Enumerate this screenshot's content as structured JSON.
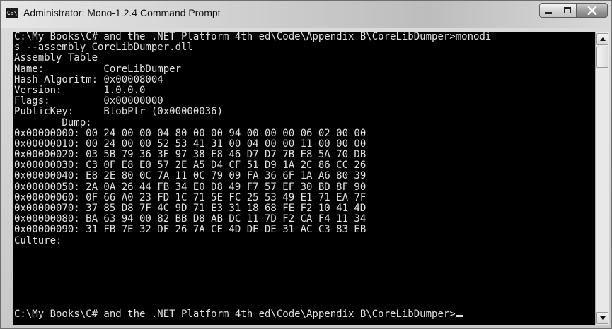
{
  "window": {
    "title": "Administrator: Mono-1.2.4 Command Prompt",
    "icon_name": "console-app-icon",
    "icon_text": "C:\\"
  },
  "controls": {
    "minimize_icon": "minimize-icon",
    "maximize_icon": "maximize-icon",
    "close_icon": "close-icon",
    "close_glyph": "✕"
  },
  "console": {
    "background": "#000000",
    "foreground": "#e0e0e0",
    "lines": [
      "C:\\My Books\\C# and the .NET Platform 4th ed\\Code\\Appendix B\\CoreLibDumper>monodi",
      "s --assembly CoreLibDumper.dll",
      "Assembly Table",
      "Name:          CoreLibDumper",
      "Hash Algoritm: 0x00008004",
      "Version:       1.0.0.0",
      "Flags:         0x00000000",
      "PublicKey:     BlobPtr (0x00000036)",
      "        Dump:",
      "0x00000000: 00 24 00 00 04 80 00 00 94 00 00 00 06 02 00 00",
      "0x00000010: 00 24 00 00 52 53 41 31 00 04 00 00 11 00 00 00",
      "0x00000020: 03 5B 79 36 3E 97 38 E8 46 D7 D7 7B E8 5A 70 DB",
      "0x00000030: C3 0F E8 E0 57 2E A5 D4 CF 51 D9 1A 2C 86 CC 26",
      "0x00000040: E8 2E 80 0C 7A 11 0C 79 09 FA 36 6F 1A A6 80 39",
      "0x00000050: 2A 0A 26 44 FB 34 E0 D8 49 F7 57 EF 30 BD 8F 90",
      "0x00000060: 0F 66 A0 23 FD 1C 71 5E FC 25 53 49 E1 71 EA 7F",
      "0x00000070: 37 85 D8 7F 4C 9D 71 E3 31 18 68 FE F2 10 41 4D",
      "0x00000080: BA 63 94 00 82 BB D8 AB DC 11 7D F2 CA F4 11 34",
      "0x00000090: 31 FB 7E 32 DF 26 7A CE 4D DE DE 31 AC C3 83 EB",
      "Culture:"
    ],
    "prompt": "C:\\My Books\\C# and the .NET Platform 4th ed\\Code\\Appendix B\\CoreLibDumper>"
  },
  "scrollbar": {
    "up_icon": "scroll-up-arrow-icon",
    "down_icon": "scroll-down-arrow-icon"
  }
}
